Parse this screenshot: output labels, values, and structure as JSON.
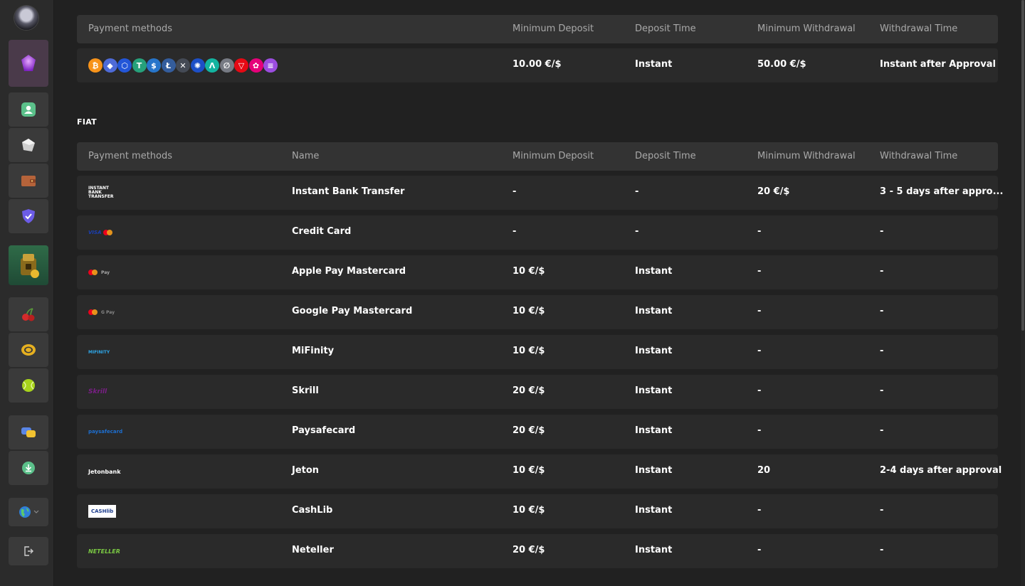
{
  "crypto_table": {
    "headers": {
      "methods": "Payment methods",
      "min_deposit": "Minimum Deposit",
      "deposit_time": "Deposit Time",
      "min_withdrawal": "Minimum Withdrawal",
      "withdrawal_time": "Withdrawal Time"
    },
    "row": {
      "coins": [
        {
          "icon": "bitcoin-icon",
          "glyph": "₿",
          "color": "#f7931a"
        },
        {
          "icon": "ethereum-icon",
          "glyph": "◆",
          "color": "#4e6bd8"
        },
        {
          "icon": "cardano-icon",
          "glyph": "⬡",
          "color": "#2356d8"
        },
        {
          "icon": "tether-icon",
          "glyph": "T",
          "color": "#26a17b"
        },
        {
          "icon": "usdc-icon",
          "glyph": "$",
          "color": "#2775ca"
        },
        {
          "icon": "litecoin-icon",
          "glyph": "Ł",
          "color": "#345d9d"
        },
        {
          "icon": "ripple-icon",
          "glyph": "✕",
          "color": "#444a55"
        },
        {
          "icon": "cardano-ada-icon",
          "glyph": "✺",
          "color": "#1d4fc7"
        },
        {
          "icon": "algorand-icon",
          "glyph": "Λ",
          "color": "#13b4a0"
        },
        {
          "icon": "stellar-icon",
          "glyph": "∅",
          "color": "#777b84"
        },
        {
          "icon": "tron-icon",
          "glyph": "▽",
          "color": "#e50914"
        },
        {
          "icon": "polkadot-icon",
          "glyph": "✿",
          "color": "#e6007a"
        },
        {
          "icon": "solana-icon",
          "glyph": "≡",
          "color": "#9b4de0"
        }
      ],
      "min_deposit": "10.00 €/$",
      "deposit_time": "Instant",
      "min_withdrawal": "50.00 €/$",
      "withdrawal_time": "Instant after Approval"
    }
  },
  "fiat_section": {
    "label": "FIAT",
    "headers": {
      "methods": "Payment methods",
      "name": "Name",
      "min_deposit": "Minimum Deposit",
      "deposit_time": "Deposit Time",
      "min_withdrawal": "Minimum Withdrawal",
      "withdrawal_time": "Withdrawal Time"
    },
    "rows": [
      {
        "logo": "instant-bank-transfer-logo",
        "logo_text": "INSTANT BANK TRANSFER",
        "name": "Instant Bank Transfer",
        "min_deposit": "-",
        "deposit_time": "-",
        "min_withdrawal": "20 €/$",
        "withdrawal_time": "3 - 5 days after appro..."
      },
      {
        "logo": "credit-card-logo",
        "logo_text": "VISA",
        "name": "Credit Card",
        "min_deposit": "-",
        "deposit_time": "-",
        "min_withdrawal": "-",
        "withdrawal_time": "-"
      },
      {
        "logo": "apple-pay-mastercard-logo",
        "logo_text": "Pay",
        "name": "Apple Pay Mastercard",
        "min_deposit": "10 €/$",
        "deposit_time": "Instant",
        "min_withdrawal": "-",
        "withdrawal_time": "-"
      },
      {
        "logo": "google-pay-mastercard-logo",
        "logo_text": "G Pay",
        "name": "Google Pay Mastercard",
        "min_deposit": "10 €/$",
        "deposit_time": "Instant",
        "min_withdrawal": "-",
        "withdrawal_time": "-"
      },
      {
        "logo": "mifinity-logo",
        "logo_text": "MIFINITY",
        "name": "MiFinity",
        "min_deposit": "10 €/$",
        "deposit_time": "Instant",
        "min_withdrawal": "-",
        "withdrawal_time": "-"
      },
      {
        "logo": "skrill-logo",
        "logo_text": "Skrill",
        "name": "Skrill",
        "min_deposit": "20 €/$",
        "deposit_time": "Instant",
        "min_withdrawal": "-",
        "withdrawal_time": "-"
      },
      {
        "logo": "paysafecard-logo",
        "logo_text": "paysafecard",
        "name": "Paysafecard",
        "min_deposit": "20 €/$",
        "deposit_time": "Instant",
        "min_withdrawal": "-",
        "withdrawal_time": "-"
      },
      {
        "logo": "jetonbank-logo",
        "logo_text": "Jetonbank",
        "name": "Jeton",
        "min_deposit": "10 €/$",
        "deposit_time": "Instant",
        "min_withdrawal": "20",
        "withdrawal_time": "2-4 days after approval"
      },
      {
        "logo": "cashlib-logo",
        "logo_text": "CASHlib",
        "name": "CashLib",
        "min_deposit": "10 €/$",
        "deposit_time": "Instant",
        "min_withdrawal": "-",
        "withdrawal_time": "-"
      },
      {
        "logo": "neteller-logo",
        "logo_text": "NETELLER",
        "name": "Neteller",
        "min_deposit": "20 €/$",
        "deposit_time": "Instant",
        "min_withdrawal": "-",
        "withdrawal_time": "-"
      }
    ]
  },
  "sidebar": {
    "items": [
      {
        "name": "sidebar-vip-button",
        "icon": "gem-icon"
      },
      {
        "name": "sidebar-profile-button",
        "icon": "user-icon"
      },
      {
        "name": "sidebar-games-button",
        "icon": "dice-icon"
      },
      {
        "name": "sidebar-wallet-button",
        "icon": "wallet-icon"
      },
      {
        "name": "sidebar-security-button",
        "icon": "shield-icon"
      },
      {
        "name": "sidebar-promo-button",
        "icon": "treasure-icon"
      },
      {
        "name": "sidebar-slots-button",
        "icon": "cherry-icon"
      },
      {
        "name": "sidebar-live-casino-button",
        "icon": "chip-icon"
      },
      {
        "name": "sidebar-sports-button",
        "icon": "tennis-ball-icon"
      },
      {
        "name": "sidebar-chat-button",
        "icon": "chat-icon"
      },
      {
        "name": "sidebar-download-button",
        "icon": "download-icon"
      },
      {
        "name": "sidebar-language-button",
        "icon": "globe-icon"
      },
      {
        "name": "sidebar-logout-button",
        "icon": "logout-icon"
      }
    ]
  }
}
